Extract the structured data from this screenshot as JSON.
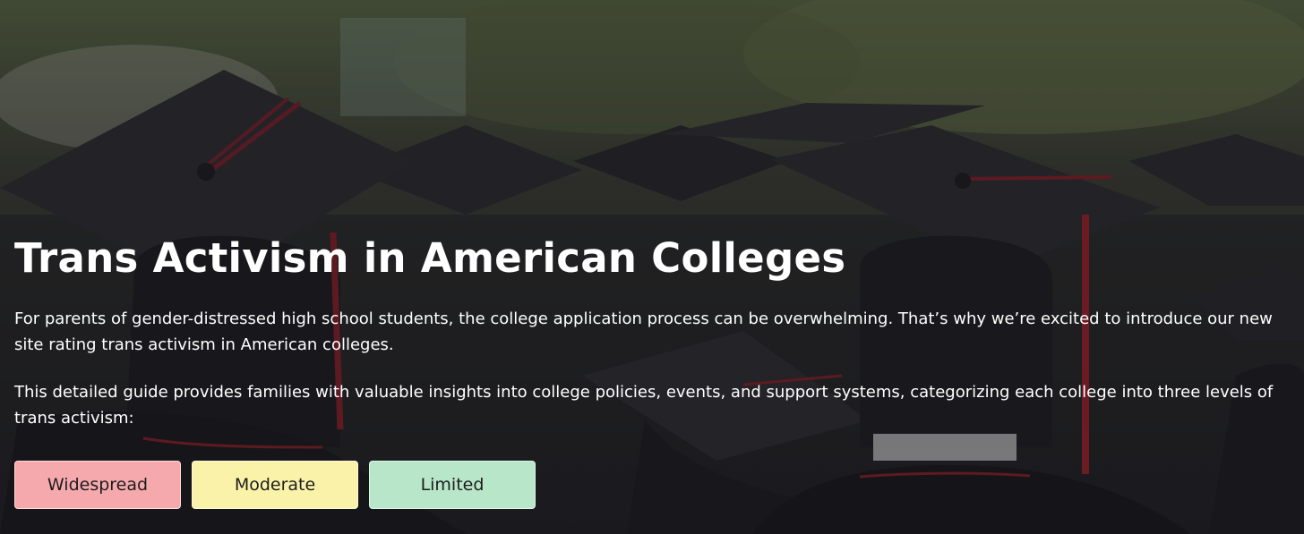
{
  "hero": {
    "background_icon": "graduation-caps-photo",
    "title": "Trans Activism in American Colleges",
    "paragraphs": [
      "For parents of gender-distressed high school students, the college application process can be overwhelming. That’s why we’re excited to introduce our new site rating trans activism in American colleges.",
      "This detailed guide provides families with valuable insights into college policies, events, and support systems, categorizing each college into three levels of trans activism:"
    ]
  },
  "levels": [
    {
      "label": "Widespread",
      "color": "#f6a9ac"
    },
    {
      "label": "Moderate",
      "color": "#fbf2a9"
    },
    {
      "label": "Limited",
      "color": "#b7e6c9"
    }
  ]
}
